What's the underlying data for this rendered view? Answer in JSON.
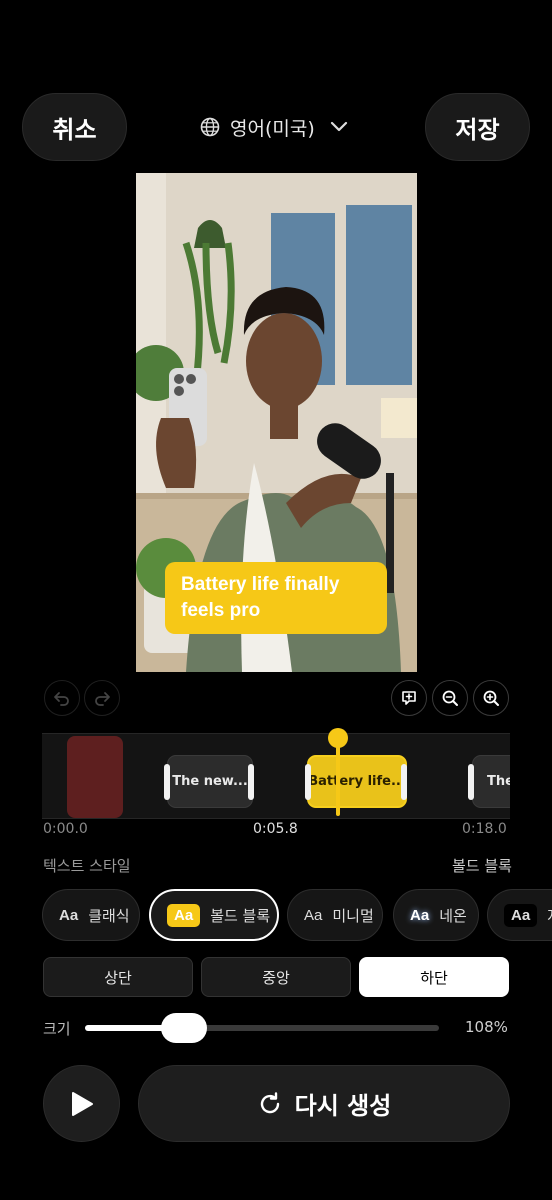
{
  "header": {
    "cancel_label": "취소",
    "save_label": "저장",
    "language_label": "영어(미국)",
    "language_icon": "globe-icon",
    "dropdown_icon": "chevron-down-icon"
  },
  "video": {
    "caption_text": "Battery life finally feels pro"
  },
  "toolbar": {
    "undo_icon": "undo-icon",
    "redo_icon": "redo-icon",
    "add_caption_icon": "add-caption-icon",
    "zoom_out_icon": "zoom-out-icon",
    "zoom_in_icon": "zoom-in-icon"
  },
  "timeline": {
    "clips": [
      {
        "label": "The new..."
      },
      {
        "label": "Battery life..."
      },
      {
        "label": "The"
      }
    ],
    "start_time": "0:00.0",
    "current_time": "0:05.8",
    "end_time": "0:18.0"
  },
  "text_style": {
    "section_label": "텍스트 스타일",
    "selected_value": "볼드 블록",
    "styles": [
      {
        "aa": "Aa",
        "label": "클래식"
      },
      {
        "aa": "Aa",
        "label": "볼드 블록"
      },
      {
        "aa": "Aa",
        "label": "미니멀"
      },
      {
        "aa": "Aa",
        "label": "네온"
      },
      {
        "aa": "Aa",
        "label": "자"
      }
    ]
  },
  "position": {
    "options": [
      "상단",
      "중앙",
      "하단"
    ],
    "selected": "하단"
  },
  "size": {
    "label": "크기",
    "value_text": "108%",
    "slider_fraction": 0.28
  },
  "bottom": {
    "play_icon": "play-icon",
    "regen_icon": "refresh-icon",
    "regen_label": "다시 생성"
  },
  "colors": {
    "accent": "#f6c817",
    "background": "#000000"
  }
}
